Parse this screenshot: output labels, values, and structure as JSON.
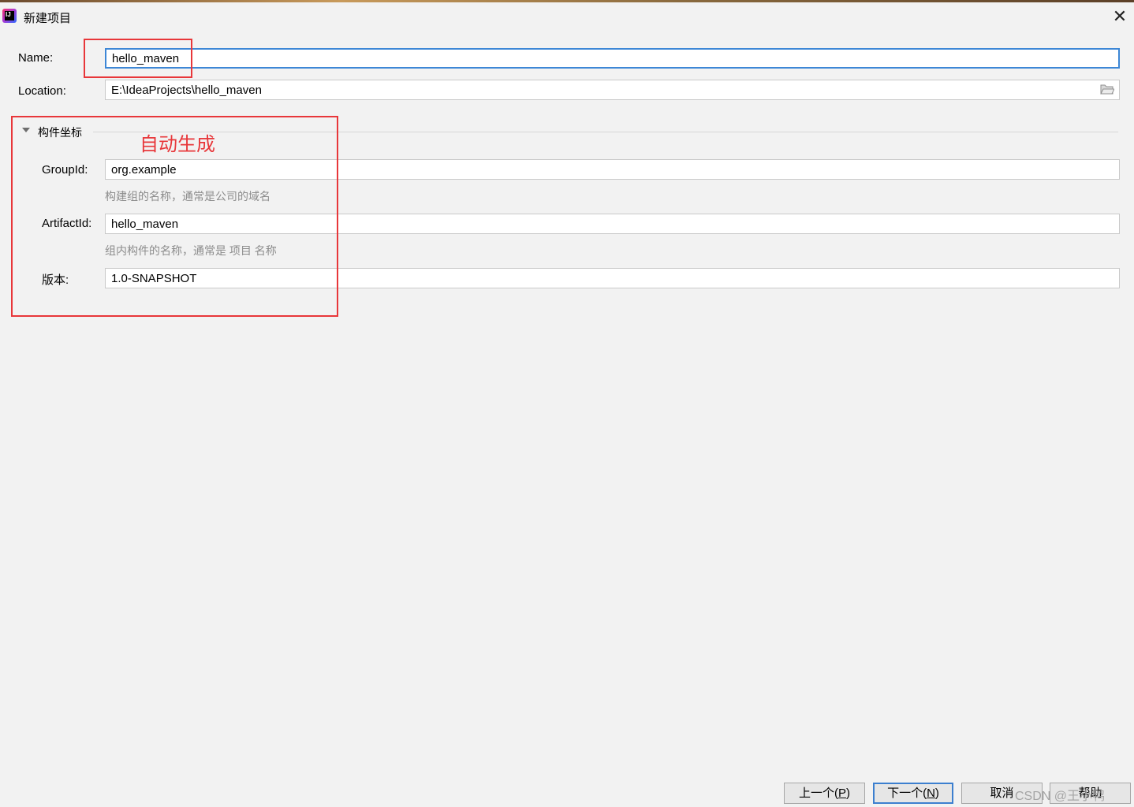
{
  "window": {
    "title": "新建项目",
    "close_glyph": "✕",
    "app_icon": "intellij-idea-icon"
  },
  "form": {
    "name": {
      "label": "Name:",
      "value": "hello_maven"
    },
    "location": {
      "label": "Location:",
      "value": "E:\\IdeaProjects\\hello_maven",
      "browse_icon": "folder-icon"
    }
  },
  "artifact_section": {
    "title": "构件坐标",
    "expanded": true,
    "group_id": {
      "label": "GroupId:",
      "value": "org.example",
      "hint": "构建组的名称，通常是公司的域名"
    },
    "artifact_id": {
      "label": "ArtifactId:",
      "value": "hello_maven",
      "hint": "组内构件的名称，通常是 项目 名称"
    },
    "version": {
      "label": "版本:",
      "value": "1.0-SNAPSHOT"
    }
  },
  "annotation": {
    "text": "自动生成",
    "color": "#e8373a"
  },
  "footer": {
    "prev_label": "上一个(",
    "prev_mnemonic": "P",
    "next_label": "下一个(",
    "next_mnemonic": "N",
    "mnemonic_close": ")",
    "cancel_label": "取消",
    "help_label": "帮助"
  },
  "watermark": "CSDN @王小鸭",
  "colors": {
    "background": "#f2f2f2",
    "focus_border": "#3d87d6",
    "hint_text": "#8c8c8c"
  }
}
